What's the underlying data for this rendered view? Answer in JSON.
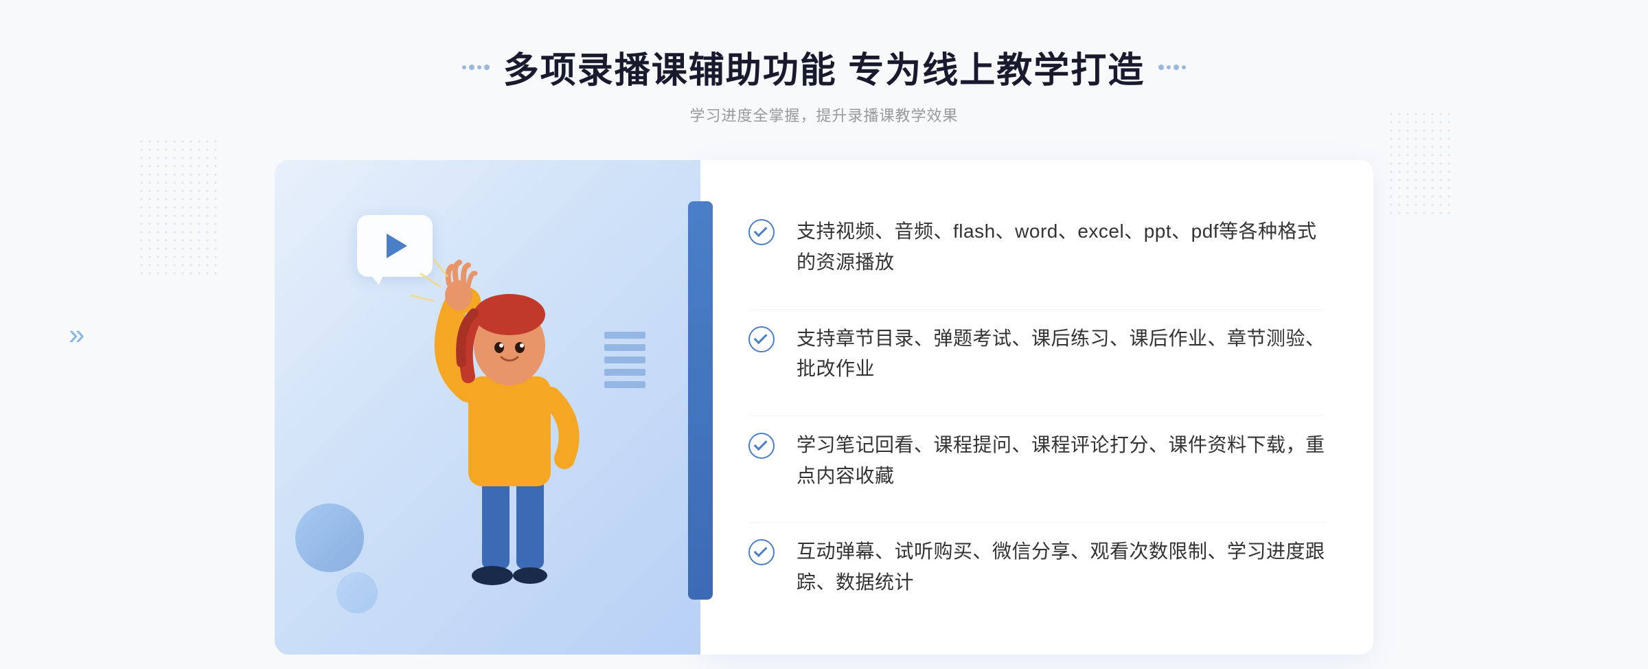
{
  "header": {
    "title": "多项录播课辅助功能 专为线上教学打造",
    "subtitle": "学习进度全掌握，提升录播课教学效果",
    "title_dots_left": "···",
    "title_dots_right": "···"
  },
  "features": [
    {
      "id": "feature-1",
      "text": "支持视频、音频、flash、word、excel、ppt、pdf等各种格式的资源播放"
    },
    {
      "id": "feature-2",
      "text": "支持章节目录、弹题考试、课后练习、课后作业、章节测验、批改作业"
    },
    {
      "id": "feature-3",
      "text": "学习笔记回看、课程提问、课程评论打分、课件资料下载，重点内容收藏"
    },
    {
      "id": "feature-4",
      "text": "互动弹幕、试听购买、微信分享、观看次数限制、学习进度跟踪、数据统计"
    }
  ],
  "colors": {
    "primary": "#4a7fc8",
    "text_dark": "#1a1a2e",
    "text_medium": "#333333",
    "text_light": "#999999",
    "bg": "#f8f9fb"
  },
  "icons": {
    "check": "check-circle-icon",
    "play": "play-icon",
    "arrow": "arrow-right-icon"
  }
}
